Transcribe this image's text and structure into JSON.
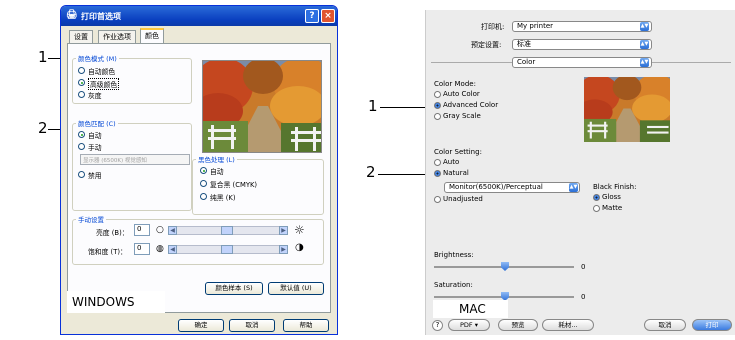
{
  "callouts": [
    "1",
    "2"
  ],
  "windows": {
    "title": "打印首选项",
    "tabs": [
      "设置",
      "作业选项",
      "颜色"
    ],
    "color_mode": {
      "title": "颜色模式 (M)",
      "options": [
        "自动颜色",
        "高级颜色",
        "灰度"
      ],
      "selected": 1
    },
    "color_matching": {
      "title": "颜色匹配 (C)",
      "options": [
        "自动",
        "手动"
      ],
      "selected": 0,
      "dropdown": "显示器 (6500K) 视觉感知",
      "disable": "禁用"
    },
    "black_finish": {
      "title": "黑色处理 (L)",
      "options": [
        "自动",
        "复合黑 (CMYK)",
        "纯黑 (K)"
      ],
      "selected": 0
    },
    "manual": {
      "title": "手动设置",
      "brightness_label": "亮度 (B)：",
      "brightness_value": "0",
      "saturation_label": "饱和度 (T)：",
      "saturation_value": "0"
    },
    "buttons": {
      "color_sample": "颜色样本 (S)",
      "defaults": "默认值 (U)",
      "ok": "确定",
      "cancel": "取消",
      "help": "帮助"
    },
    "platform_label": "WINDOWS"
  },
  "mac": {
    "printer_label": "打印机:",
    "printer_value": "My printer",
    "preset_label": "预定设置:",
    "preset_value": "标准",
    "panel_value": "Color",
    "color_mode_title": "Color Mode:",
    "color_mode_options": [
      "Auto Color",
      "Advanced Color",
      "Gray Scale"
    ],
    "color_mode_selected": 1,
    "color_setting_title": "Color Setting:",
    "color_setting_options": [
      "Auto",
      "Natural"
    ],
    "color_setting_selected": 1,
    "monitor_value": "Monitor(6500K)/Perceptual",
    "unadjusted": "Unadjusted",
    "black_finish_title": "Black Finish:",
    "black_finish_options": [
      "Gloss",
      "Matte"
    ],
    "black_finish_selected": 0,
    "brightness_label": "Brightness:",
    "brightness_value": "0",
    "saturation_label": "Saturation:",
    "saturation_value": "0",
    "help_icon": "?",
    "pdf_button": "PDF ▾",
    "preview_button": "预览",
    "supplies_button": "耗材...",
    "cancel_button": "取消",
    "print_button": "打印",
    "platform_label": "MAC"
  },
  "colors": {
    "xp_title": "#0a3fbf",
    "xp_panel": "#ece9d8",
    "mac_bg": "#ececec",
    "accent": "#2b6fd6"
  }
}
